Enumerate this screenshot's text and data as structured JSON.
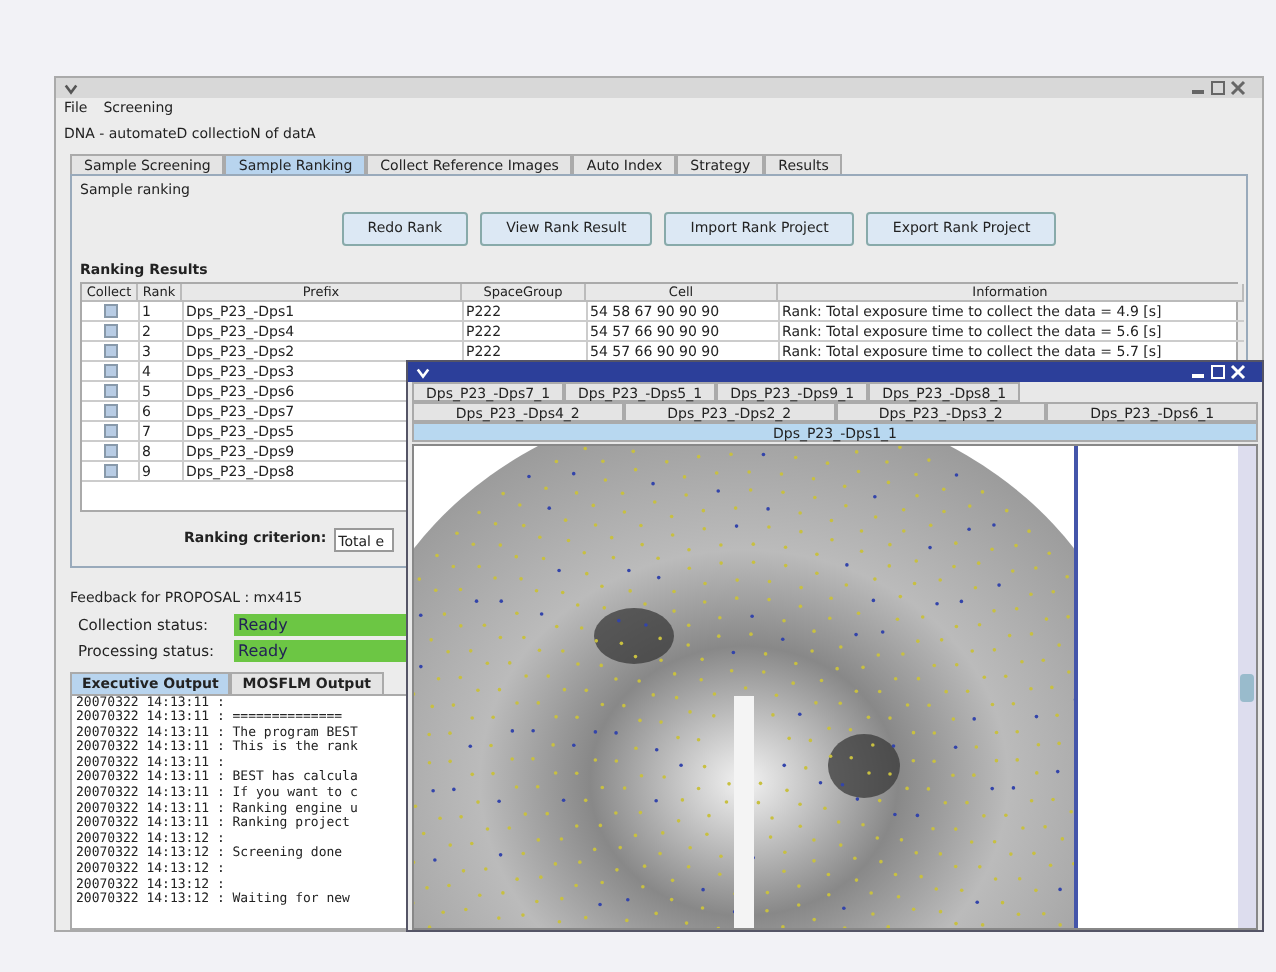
{
  "menu": [
    "File",
    "Screening"
  ],
  "group_title": "DNA - automateD collectioN of datA",
  "tabs": [
    {
      "label": "Sample Screening",
      "selected": false
    },
    {
      "label": "Sample Ranking",
      "selected": true
    },
    {
      "label": "Collect Reference Images",
      "selected": false
    },
    {
      "label": "Auto Index",
      "selected": false
    },
    {
      "label": "Strategy",
      "selected": false
    },
    {
      "label": "Results",
      "selected": false
    }
  ],
  "panel_title": "Sample ranking",
  "buttons": [
    "Redo Rank",
    "View Rank Result",
    "Import Rank Project",
    "Export Rank Project"
  ],
  "results_title": "Ranking Results",
  "table": {
    "columns": [
      "Collect",
      "Rank",
      "Prefix",
      "SpaceGroup",
      "Cell",
      "Information"
    ],
    "rows": [
      {
        "checked": false,
        "rank": "1",
        "prefix": "Dps_P23_-Dps1",
        "spacegroup": "P222",
        "cell": "54 58 67 90 90 90",
        "information": "Rank: Total exposure time to collect the data = 4.9 [s]"
      },
      {
        "checked": false,
        "rank": "2",
        "prefix": "Dps_P23_-Dps4",
        "spacegroup": "P222",
        "cell": "54 57 66 90 90 90",
        "information": "Rank: Total exposure time to collect the data = 5.6 [s]"
      },
      {
        "checked": false,
        "rank": "3",
        "prefix": "Dps_P23_-Dps2",
        "spacegroup": "P222",
        "cell": "54 57 66 90 90 90",
        "information": "Rank: Total exposure time to collect the data = 5.7 [s]"
      },
      {
        "checked": false,
        "rank": "4",
        "prefix": "Dps_P23_-Dps3"
      },
      {
        "checked": false,
        "rank": "5",
        "prefix": "Dps_P23_-Dps6"
      },
      {
        "checked": false,
        "rank": "6",
        "prefix": "Dps_P23_-Dps7"
      },
      {
        "checked": false,
        "rank": "7",
        "prefix": "Dps_P23_-Dps5"
      },
      {
        "checked": false,
        "rank": "8",
        "prefix": "Dps_P23_-Dps9"
      },
      {
        "checked": false,
        "rank": "9",
        "prefix": "Dps_P23_-Dps8"
      }
    ]
  },
  "criterion": {
    "label": "Ranking criterion:",
    "value": "Total e"
  },
  "feedback": {
    "title": "Feedback for PROPOSAL : mx415",
    "statuses": [
      {
        "label": "Collection status:",
        "value": "Ready"
      },
      {
        "label": "Processing status:",
        "value": "Ready"
      }
    ]
  },
  "output_tabs": [
    {
      "label": "Executive Output",
      "selected": true
    },
    {
      "label": "MOSFLM Output",
      "selected": false
    }
  ],
  "log": [
    "20070322 14:13:11 :",
    "20070322 14:13:11 : ==============",
    "20070322 14:13:11 : The program BEST",
    "20070322 14:13:11 : This is the rank",
    "20070322 14:13:11 :",
    "20070322 14:13:11 : BEST has calcula",
    "20070322 14:13:11 : If you want to c",
    "20070322 14:13:11 : Ranking engine u",
    "20070322 14:13:11 : Ranking project",
    "20070322 14:13:12 :",
    "20070322 14:13:12 : Screening done",
    "20070322 14:13:12 :",
    "20070322 14:13:12 :",
    "20070322 14:13:12 : Waiting for new"
  ],
  "viewer": {
    "tab_rows": [
      [
        {
          "label": "Dps_P23_-Dps7_1",
          "selected": false
        },
        {
          "label": "Dps_P23_-Dps5_1",
          "selected": false
        },
        {
          "label": "Dps_P23_-Dps9_1",
          "selected": false
        },
        {
          "label": "Dps_P23_-Dps8_1",
          "selected": false
        }
      ],
      [
        {
          "label": "Dps_P23_-Dps4_2",
          "selected": false
        },
        {
          "label": "Dps_P23_-Dps2_2",
          "selected": false
        },
        {
          "label": "Dps_P23_-Dps3_2",
          "selected": false
        },
        {
          "label": "Dps_P23_-Dps6_1",
          "selected": false
        }
      ],
      [
        {
          "label": "Dps_P23_-Dps1_1",
          "selected": true
        }
      ]
    ]
  }
}
